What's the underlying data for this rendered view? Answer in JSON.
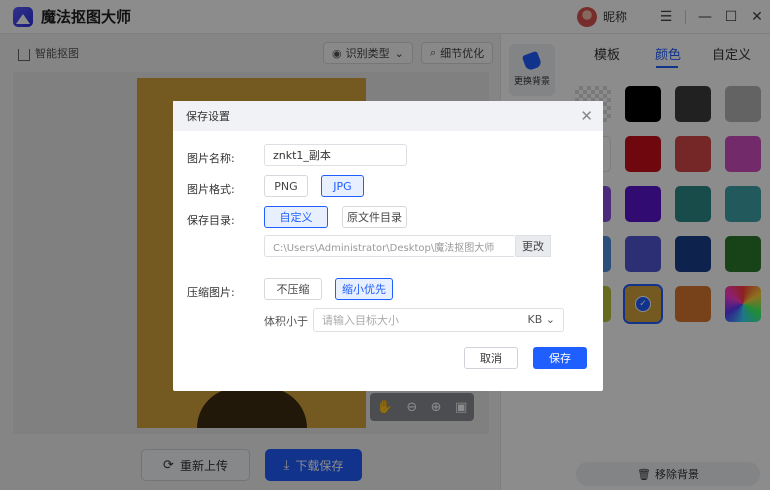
{
  "app": {
    "title": "魔法抠图大师",
    "nickname": "昵称",
    "window_buttons": [
      "menu-icon",
      "minimize-icon",
      "maximize-icon",
      "close-icon"
    ]
  },
  "toolbar": {
    "smart_matting": "智能抠图",
    "recognize_type": "识别类型",
    "detail_optimize": "细节优化"
  },
  "side_strip": {
    "replace_bg": "更换背景"
  },
  "right_panel": {
    "tabs": [
      {
        "label": "模板"
      },
      {
        "label": "颜色",
        "active": true
      },
      {
        "label": "自定义"
      }
    ],
    "swatches": [
      "transparent",
      "#000000",
      "#3d3d3d",
      "#b5b5b5",
      "#ffffff",
      "#c8101a",
      "#d64545",
      "#d14ec4",
      "#8a4fe0",
      "#5a13cf",
      "#2a8a87",
      "#3fa3a8",
      "#4f8fe0",
      "#5057d4",
      "#1a3e8f",
      "#2c7a2c",
      "#b7c33d",
      "#d4a43c",
      "#d9772f",
      "gradient"
    ],
    "selected_swatch": "#d4a43c",
    "remove_bg": "移除背景"
  },
  "bottom": {
    "reupload": "重新上传",
    "download_save": "下载保存"
  },
  "dialog": {
    "title": "保存设置",
    "name_label": "图片名称:",
    "name_value": "znkt1_副本",
    "format_label": "图片格式:",
    "formats": [
      {
        "label": "PNG"
      },
      {
        "label": "JPG",
        "selected": true
      }
    ],
    "dir_label": "保存目录:",
    "dir_options": [
      {
        "label": "自定义",
        "selected": true
      },
      {
        "label": "原文件目录"
      }
    ],
    "path_value": "C:\\Users\\Administrator\\Desktop\\魔法抠图大师",
    "change_btn": "更改",
    "compress_label": "压缩图片:",
    "compress_options": [
      {
        "label": "不压缩"
      },
      {
        "label": "缩小优先",
        "selected": true
      }
    ],
    "size_label": "体积小于",
    "size_placeholder": "请输入目标大小",
    "size_unit": "KB",
    "cancel": "取消",
    "save": "保存"
  }
}
